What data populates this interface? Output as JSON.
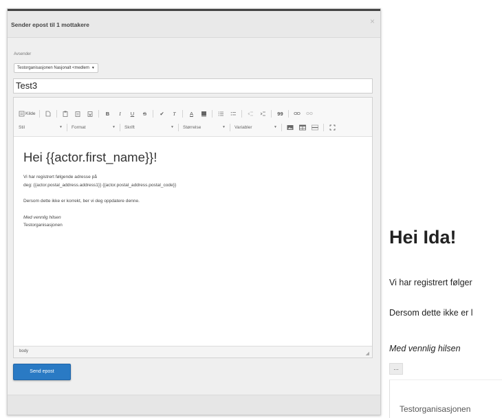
{
  "modal": {
    "title": "Sender epost til 1 mottakere",
    "close_icon": "×",
    "from_label": "Avsender",
    "from_value": "Testorganisasjonen Nasjonalt <medlem",
    "subject_value": "Test3",
    "send_label": "Send epost"
  },
  "toolbar": {
    "source_label": "Kilde",
    "bold": "B",
    "italic": "I",
    "underline": "U",
    "strike": "S",
    "check": "✔",
    "clear_format": "T",
    "text_color": "A",
    "quote": "99",
    "stil": "Stil",
    "format": "Format",
    "skrift": "Skrift",
    "storrelse": "Størrelse",
    "variabler": "Variabler"
  },
  "editor": {
    "heading": "Hei {{actor.first_name}}!",
    "p1_line1": "Vi har registrert følgende adresse på",
    "p1_line2": "deg: {{actor.postal_address.address1}} {{actor.postal_address.postal_code}}",
    "p2": "Dersom dette ikke er korrekt, ber vi deg oppdatere denne.",
    "greeting": "Med vennlig hilsen",
    "signature": "Testorganisasjonen",
    "path": "body"
  },
  "preview": {
    "heading": "Hei Ida!",
    "p1": "Vi har registrert følger",
    "p2": "Dersom dette ikke er l",
    "greeting": "Med vennlig hilsen",
    "more_label": "...",
    "signature": "Testorganisasjonen"
  }
}
